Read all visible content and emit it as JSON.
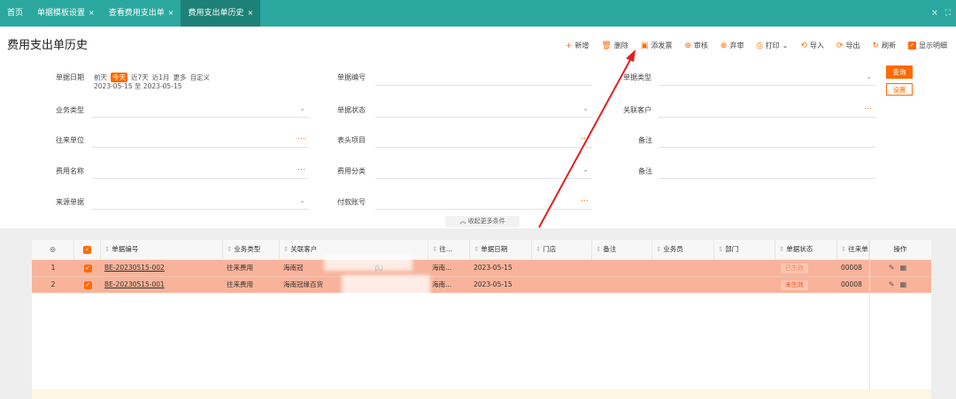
{
  "tabs": [
    {
      "label": "首页",
      "closable": false,
      "active": false
    },
    {
      "label": "单据模板设置",
      "closable": true,
      "active": false
    },
    {
      "label": "查看费用支出单",
      "closable": true,
      "active": false
    },
    {
      "label": "费用支出单历史",
      "closable": true,
      "active": true
    }
  ],
  "tab_close_glyph": "×",
  "window": {
    "close": "×",
    "fullscreen": "⛶"
  },
  "page_title": "费用支出单历史",
  "toolbar": {
    "add": "新增",
    "delete": "删除",
    "add_invoice": "添发票",
    "audit": "审核",
    "unaudit": "弃审",
    "print": "打印",
    "import": "导入",
    "export": "导出",
    "refresh": "刷新",
    "show_detail": "显示明细"
  },
  "filters": {
    "doc_date_label": "单据日期",
    "date_chips": [
      "前天",
      "今天",
      "近7天",
      "近1月",
      "更多",
      "自定义"
    ],
    "date_range": "2023-05-15 至 2023-05-15",
    "doc_no_label": "单据编号",
    "doc_type_label": "单据类型",
    "biz_type_label": "业务类型",
    "doc_status_label": "单据状态",
    "related_customer_label": "关联客户",
    "partner_label": "往来单位",
    "header_item_label": "表头项目",
    "note_label_1": "备注",
    "expense_name_label": "费用名称",
    "expense_category_label": "费用分类",
    "note_label_2": "备注",
    "source_doc_label": "来源单据",
    "payment_account_label": "付款账号",
    "query_button": "查询",
    "settings_button": "设置",
    "collapse": "收起更多条件"
  },
  "table": {
    "headers": [
      "单据编号",
      "业务类型",
      "关联客户",
      "往...",
      "单据日期",
      "门店",
      "备注",
      "业务员",
      "部门",
      "单据状态",
      "往来单",
      "操作"
    ],
    "rows": [
      {
        "index": "1",
        "doc_no": "BE-20230515-002",
        "biz_type": "往来费用",
        "customer": "海南冠",
        "customer_suffix": "衣)",
        "partner": "海南...",
        "date": "2023-05-15",
        "status": "已生效",
        "partner_doc": "00008"
      },
      {
        "index": "2",
        "doc_no": "BE-20230515-001",
        "biz_type": "往来费用",
        "customer": "海南冠缘百货",
        "customer_suffix": "",
        "partner": "海南...",
        "date": "2023-05-15",
        "status": "未生效",
        "partner_doc": "00008"
      }
    ]
  },
  "colors": {
    "topbar": "#2aa89f",
    "active_tab": "#1d8178",
    "accent": "#ff6a00",
    "row_highlight": "#f9b39a",
    "annotation_arrow": "#e02020"
  }
}
